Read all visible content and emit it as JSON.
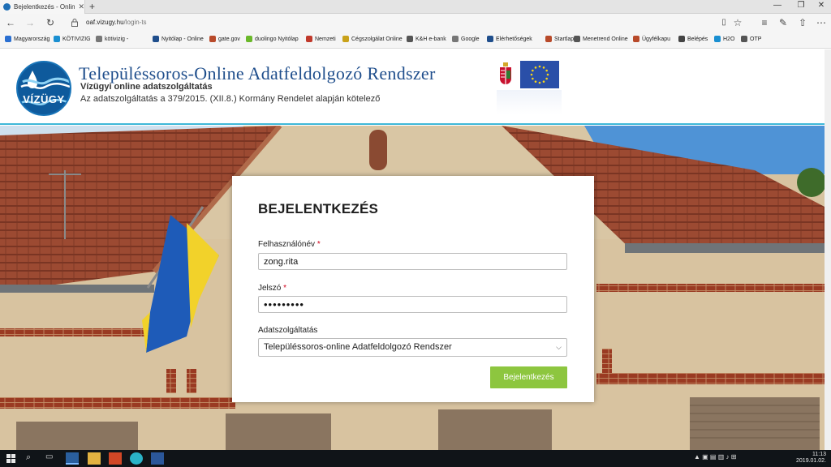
{
  "browser": {
    "tab_title": "Bejelentkezés - Online A",
    "url_host": "oaf.vizugy.hu",
    "url_path": "/login-ts"
  },
  "favorites": [
    {
      "label": "Magyarország",
      "icon": "globe-icon",
      "color": "#2a6fd1"
    },
    {
      "label": "KÖTIVIZIG",
      "icon": "water-icon",
      "color": "#1a8fd1"
    },
    {
      "label": "kötivizig -",
      "icon": "g-icon",
      "color": "#777777"
    },
    {
      "label": "Nyitólap - Online",
      "icon": "globe-icon",
      "color": "#1f4e8c"
    },
    {
      "label": "gate.gov",
      "icon": "bird-icon",
      "color": "#b84a2a"
    },
    {
      "label": "duolingo Nyitólap",
      "icon": "owl-icon",
      "color": "#6ab82a"
    },
    {
      "label": "Nemzeti",
      "icon": "flag-icon",
      "color": "#c0392b"
    },
    {
      "label": "Cégszolgálat Online",
      "icon": "c-icon",
      "color": "#c9a21a"
    },
    {
      "label": "K&H e-bank",
      "icon": "star-icon",
      "color": "#555555"
    },
    {
      "label": "Google",
      "icon": "g-icon",
      "color": "#777777"
    },
    {
      "label": "Elérhetőségek",
      "icon": "globe-icon",
      "color": "#1f4e8c"
    },
    {
      "label": "Startlap -",
      "icon": "bird-icon",
      "color": "#b84a2a"
    },
    {
      "label": "Menetrend Online",
      "icon": "star-icon",
      "color": "#555555"
    },
    {
      "label": "Ügyfélkapu",
      "icon": "bird-icon",
      "color": "#b84a2a"
    },
    {
      "label": "Belépés",
      "icon": "globe-icon",
      "color": "#444444"
    },
    {
      "label": "H2O",
      "icon": "water-icon",
      "color": "#1a8fd1"
    },
    {
      "label": "OTP",
      "icon": "star-icon",
      "color": "#555555"
    }
  ],
  "header": {
    "logo_text": "VÍZÜGY",
    "title": "Településsoros-Online Adatfeldolgozó Rendszer",
    "subtitle": "Vízügyi online adatszolgáltatás",
    "note": "Az adatszolgáltatás a 379/2015. (XII.8.) Kormány Rendelet alapján kötelező"
  },
  "login": {
    "title": "BEJELENTKEZÉS",
    "username_label": "Felhasználónév",
    "username_value": "zong.rita",
    "password_label": "Jelszó",
    "password_value": "•••••••••",
    "required_mark": "*",
    "service_label": "Adatszolgáltatás",
    "service_selected": "Településsoros-online Adatfeldolgozó Rendszer",
    "submit_label": "Bejelentkezés"
  },
  "taskbar": {
    "time": "11:13",
    "date": "2019.01.02."
  },
  "colors": {
    "accent_green": "#8dc63f",
    "brand_blue": "#1f4e8c",
    "header_rule": "#3fb8d8",
    "required_red": "#d0021b"
  }
}
